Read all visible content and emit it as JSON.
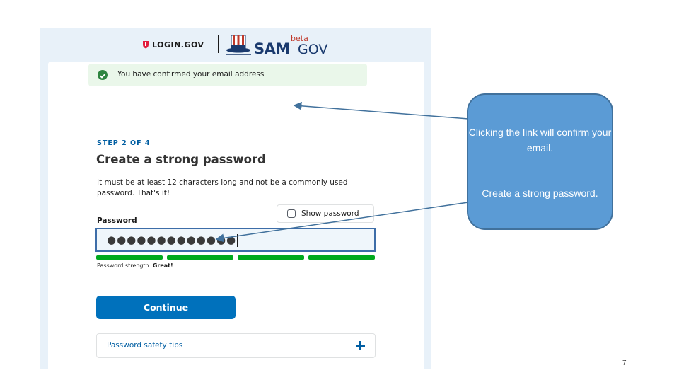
{
  "header": {
    "login_logo_text": "LOGIN.GOV",
    "sam_text": "SAM",
    "sam_beta": "beta",
    "sam_gov": "GOV"
  },
  "alert": {
    "message": "You have confirmed your email address"
  },
  "form": {
    "step": "STEP 2 OF 4",
    "title": "Create a strong password",
    "description": "It must be at least 12 characters long and not be a commonly used password. That's it!",
    "password_label": "Password",
    "show_password_label": "Show password",
    "show_password_checked": false,
    "password_value": "●●●●●●●●●●●●●",
    "strength_label": "Password strength: ",
    "strength_value": "Great!",
    "strength_segments_filled": 4,
    "strength_segments_total": 4,
    "continue_label": "Continue",
    "tips_label": "Password safety tips"
  },
  "callout": {
    "line1": "Clicking the link will confirm your email.",
    "line2": "Create a strong password."
  },
  "slide": {
    "page_number": "7"
  },
  "colors": {
    "primary": "#0071bc",
    "success": "#2e8540",
    "strength_bar": "#00a91c",
    "callout_fill": "#5b9bd5",
    "callout_border": "#41719c"
  }
}
